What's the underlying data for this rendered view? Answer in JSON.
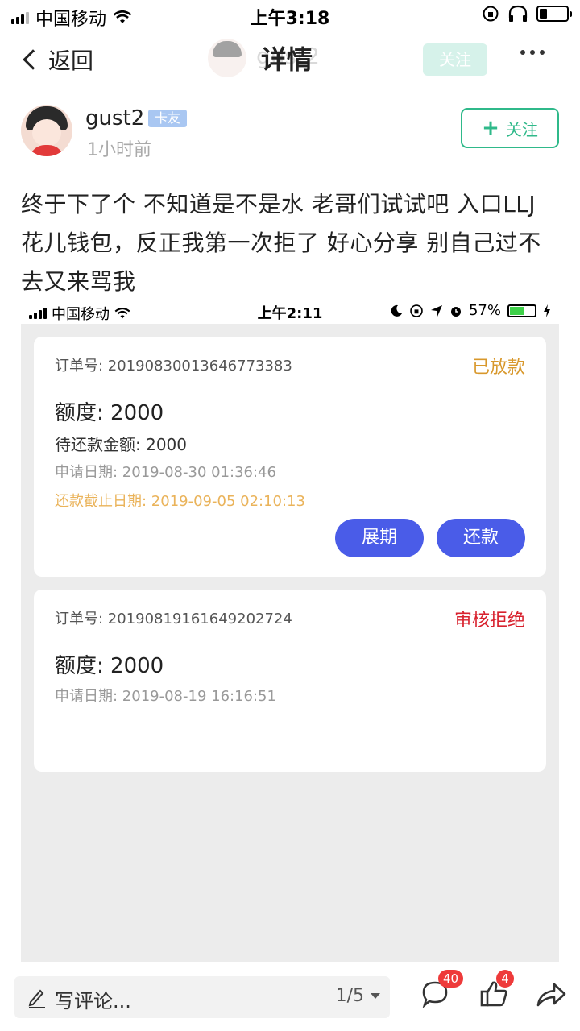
{
  "status_bar": {
    "carrier": "中国移动",
    "time": "上午3:18"
  },
  "nav": {
    "back_label": "返回",
    "title": "详情",
    "title_ghost": "gust2",
    "follow_label": "关注",
    "more_icon": "more-icon"
  },
  "author": {
    "name": "gust2",
    "badge": "卡友",
    "time": "1小时前",
    "follow_label": "关注"
  },
  "post": {
    "text": "终于下了个 不知道是不是水 老哥们试试吧 入口LLJ 花儿钱包，反正我第一次拒了 好心分享 别自己过不去又来骂我"
  },
  "screenshot": {
    "status": {
      "carrier": "中国移动",
      "time": "上午2:11",
      "battery": "57%"
    },
    "orders": [
      {
        "order_no": "订单号: 20190830013646773383",
        "status": "已放款",
        "amount": "额度: 2000",
        "pending": "待还款金额: 2000",
        "apply_date": "申请日期: 2019-08-30 01:36:46",
        "due_date": "还款截止日期: 2019-09-05 02:10:13",
        "extend_label": "展期",
        "repay_label": "还款"
      },
      {
        "order_no": "订单号: 20190819161649202724",
        "status": "审核拒绝",
        "amount": "额度: 2000",
        "apply_date": "申请日期: 2019-08-19 16:16:51"
      }
    ]
  },
  "bottom": {
    "comment_placeholder": "写评论...",
    "pager": "1/5",
    "comment_count": "40",
    "like_count": "4"
  },
  "colors": {
    "accent_green": "#2fb98a",
    "button_blue": "#4a5ce8",
    "approved": "#d8982c",
    "rejected": "#d8222e",
    "badge_red": "#ee3a3a"
  }
}
